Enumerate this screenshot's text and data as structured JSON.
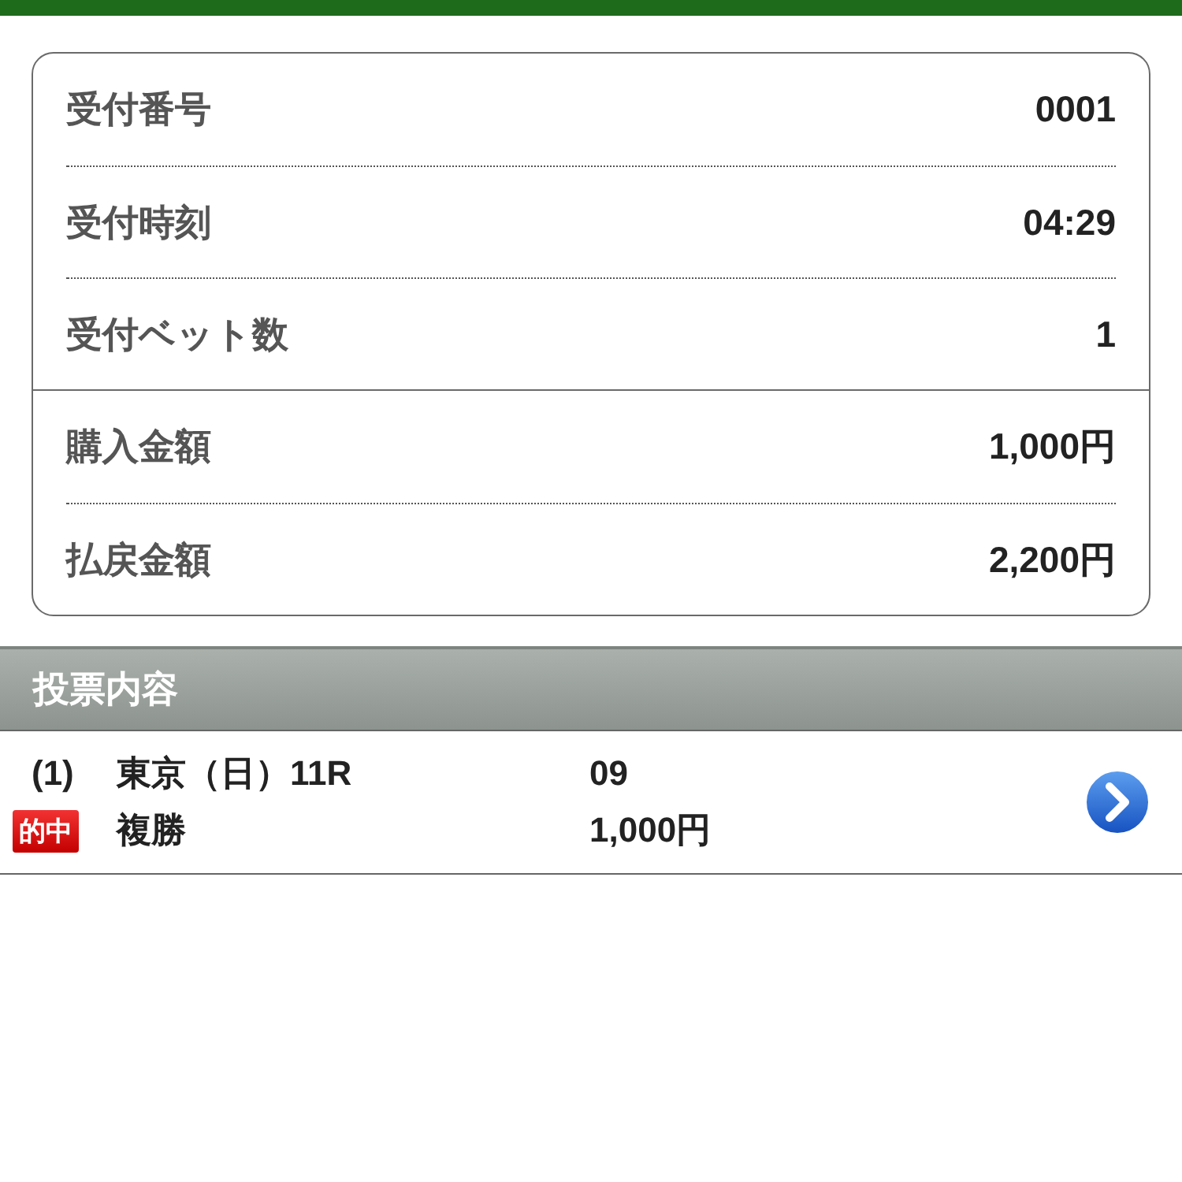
{
  "receipt": {
    "groups": [
      {
        "rows": [
          {
            "label": "受付番号",
            "value": "0001"
          },
          {
            "label": "受付時刻",
            "value": "04:29"
          },
          {
            "label": "受付ベット数",
            "value": "1"
          }
        ]
      },
      {
        "rows": [
          {
            "label": "購入金額",
            "value": "1,000円"
          },
          {
            "label": "払戻金額",
            "value": "2,200円"
          }
        ]
      }
    ]
  },
  "section": {
    "title": "投票内容"
  },
  "bets": [
    {
      "number": "(1)",
      "race": "東京（日）11R",
      "selection": "09",
      "badge": "的中",
      "bet_type": "複勝",
      "amount": "1,000円"
    }
  ]
}
